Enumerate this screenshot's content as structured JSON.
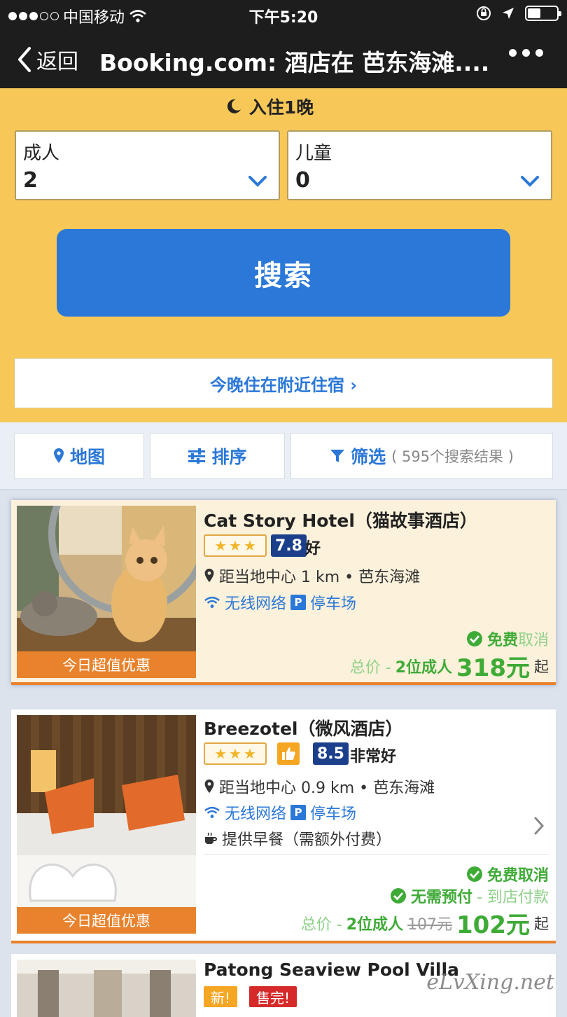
{
  "status_bar": {
    "carrier": "中国移动",
    "time": "下午5:20"
  },
  "nav": {
    "back_label": "返回",
    "title": "Booking.com: 酒店在 芭东海滩...."
  },
  "search_panel": {
    "nights": "入住1晚",
    "adults": {
      "label": "成人",
      "value": "2"
    },
    "children": {
      "label": "儿童",
      "value": "0"
    },
    "search_button": "搜索",
    "tonight_link": "今晚住在附近住宿 ›"
  },
  "toolbar": {
    "map": "地图",
    "sort": "排序",
    "filter": "筛选",
    "result_count": "( 595个搜索结果 )"
  },
  "hotels": [
    {
      "name": "Cat Story Hotel（猫故事酒店）",
      "score": "7.8",
      "score_text": "好",
      "distance": "距当地中心 1 km • 芭东海滩",
      "wifi": "无线网络",
      "parking": "停车场",
      "deal": "今日超值优惠",
      "free_cancel_a": "免费",
      "free_cancel_b": "取消",
      "price_prefix": "总价 - ",
      "price_guests": "2位成人",
      "price": "318元",
      "price_suffix": "起"
    },
    {
      "name": "Breezotel（微风酒店）",
      "score": "8.5",
      "score_text": "非常好",
      "distance": "距当地中心 0.9 km • 芭东海滩",
      "wifi": "无线网络",
      "parking": "停车场",
      "breakfast": "提供早餐（需额外付费）",
      "deal": "今日超值优惠",
      "free_cancel": "免费取消",
      "no_prepay": "无需预付",
      "pay_at_hotel": " - 到店付款",
      "price_prefix": "总价 - ",
      "price_guests": "2位成人",
      "old_price": "107元",
      "price": "102元",
      "price_suffix": "起"
    },
    {
      "name": "Patong Seaview Pool Villa",
      "tag_new": "新!",
      "tag_sold": "售完!"
    }
  ],
  "watermark": "eLvXing.net",
  "colors": {
    "accent_blue": "#2b78d8",
    "panel_yellow": "#f7c858",
    "deal_orange": "#e8822c",
    "green": "#3fab37",
    "score_navy": "#1b3f8b"
  },
  "icons": [
    "wifi-icon",
    "location-arrow-icon",
    "battery-icon",
    "back-chevron-icon",
    "more-icon",
    "moon-icon",
    "chevron-down-icon",
    "map-pin-icon",
    "sort-icon",
    "filter-icon",
    "star-icon",
    "thumbs-up-icon",
    "parking-icon",
    "coffee-icon",
    "check-circle-icon",
    "chevron-right-icon"
  ]
}
